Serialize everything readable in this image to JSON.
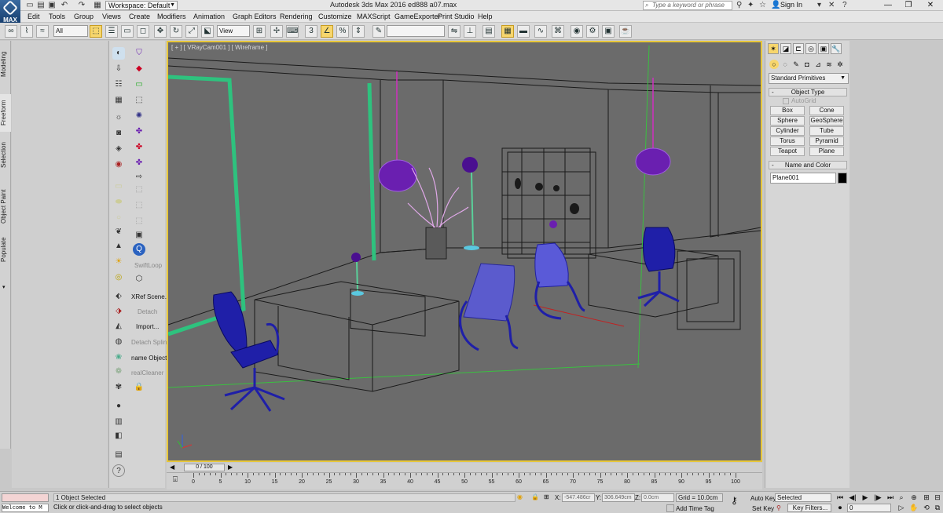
{
  "titlebar": {
    "logo_label": "MAX",
    "workspace": "Workspace: Default",
    "title": "Autodesk 3ds Max 2016     ed888 a07.max",
    "search_placeholder": "Type a keyword or phrase",
    "sign_in": "Sign In"
  },
  "menu": [
    "Edit",
    "Tools",
    "Group",
    "Views",
    "Create",
    "Modifiers",
    "Animation",
    "Graph Editors",
    "Rendering",
    "Customize",
    "MAXScript",
    "GameExporter",
    "Print Studio",
    "Help"
  ],
  "toolbar": {
    "selection_filter": "All",
    "ref_coord": "View",
    "named_sel": ""
  },
  "ribbon_tabs": [
    "Modeling",
    "Freeform",
    "Selection",
    "Object Paint",
    "Populate"
  ],
  "tools": {
    "swiftloop": "SwiftLoop",
    "xref": "XRef Scene...",
    "detach": "Detach",
    "import": "Import...",
    "detach_spline": "Detach Spline",
    "name_objects": "name Objects",
    "realcleaner": "realCleaner"
  },
  "viewport": {
    "label": "[ + ] [ VRayCam001 ] [ Wireframe ]"
  },
  "command_panel": {
    "dropdown": "Standard Primitives",
    "object_type": "Object Type",
    "autogrid": "AutoGrid",
    "buttons": [
      "Box",
      "Cone",
      "Sphere",
      "GeoSphere",
      "Cylinder",
      "Tube",
      "Torus",
      "Pyramid",
      "Teapot",
      "Plane"
    ],
    "name_color": "Name and Color",
    "object_name": "Plane001"
  },
  "timeline": {
    "handle": "0 / 100",
    "ticks": [
      "0",
      "5",
      "10",
      "15",
      "20",
      "25",
      "30",
      "35",
      "40",
      "45",
      "50",
      "55",
      "60",
      "65",
      "70",
      "75",
      "80",
      "85",
      "90",
      "95",
      "100"
    ]
  },
  "status": {
    "maxscript": "Welcome to M",
    "selection": "1 Object Selected",
    "prompt": "Click or click-and-drag to select objects",
    "x_label": "X:",
    "x_value": "-547.486cr",
    "y_label": "Y:",
    "y_value": "306.649cm",
    "z_label": "Z:",
    "z_value": "0.0cm",
    "grid": "Grid = 10.0cm",
    "add_time_tag": "Add Time Tag",
    "auto_key": "Auto Key",
    "set_key": "Set Key",
    "selected": "Selected",
    "key_filters": "Key Filters...",
    "frame": "0"
  },
  "colors": {
    "viewport_bg": "#6b6b6b",
    "viewport_border": "#e8c73a",
    "chair_blue": "#1f1fa8",
    "lamp_purple": "#6a1fb0",
    "wall_green": "#2ec27e"
  }
}
